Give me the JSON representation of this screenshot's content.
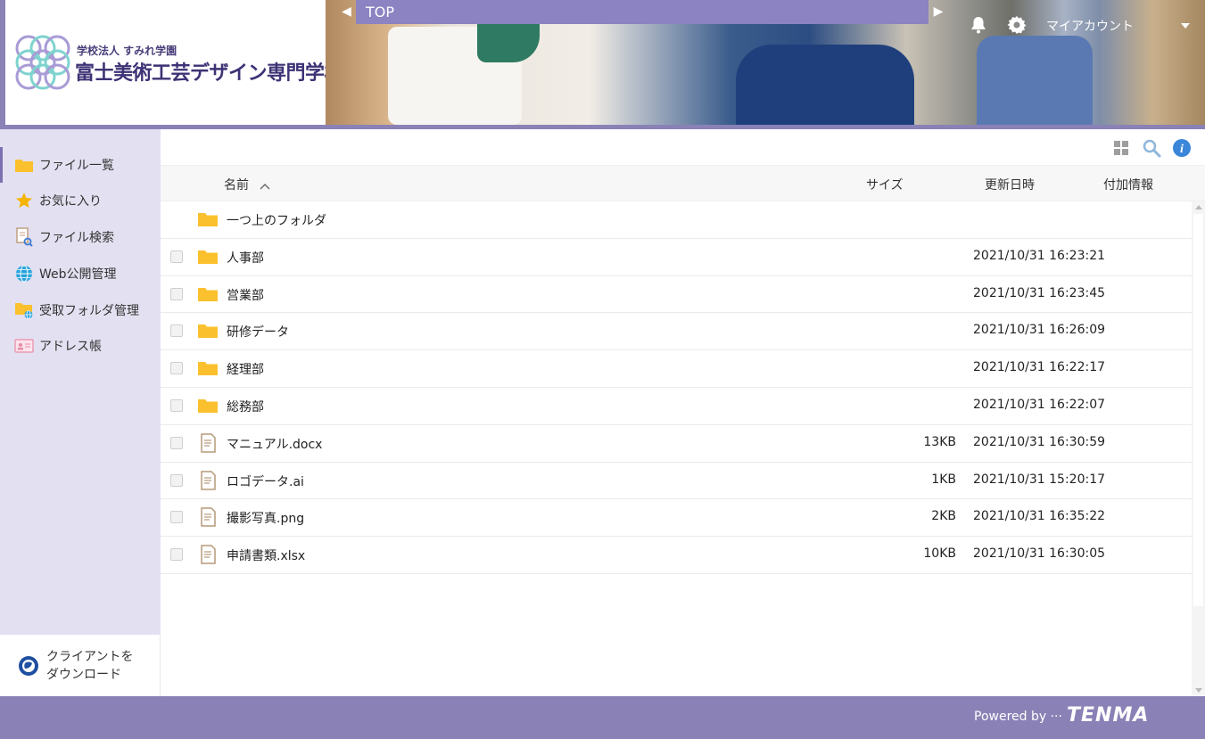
{
  "header": {
    "school_sub": "学校法人 すみれ学園",
    "school_name": "富士美術工芸デザイン専門学校",
    "top_title": "TOP",
    "account_label": "マイアカウント"
  },
  "sidebar": {
    "items": [
      {
        "label": "ファイル一覧",
        "icon": "folder-icon"
      },
      {
        "label": "お気に入り",
        "icon": "star-icon"
      },
      {
        "label": "ファイル検索",
        "icon": "file-search-icon"
      },
      {
        "label": "Web公開管理",
        "icon": "globe-icon"
      },
      {
        "label": "受取フォルダ管理",
        "icon": "folder-globe-icon"
      },
      {
        "label": "アドレス帳",
        "icon": "address-card-icon"
      }
    ],
    "client_download_line1": "クライアントを",
    "client_download_line2": "ダウンロード"
  },
  "table": {
    "columns": {
      "name": "名前",
      "size": "サイズ",
      "updated": "更新日時",
      "extra": "付加情報"
    },
    "parent_folder": "一つ上のフォルダ",
    "rows": [
      {
        "name": "人事部",
        "type": "folder",
        "size": "",
        "updated": "2021/10/31 16:23:21"
      },
      {
        "name": "営業部",
        "type": "folder",
        "size": "",
        "updated": "2021/10/31 16:23:45"
      },
      {
        "name": "研修データ",
        "type": "folder",
        "size": "",
        "updated": "2021/10/31 16:26:09"
      },
      {
        "name": "経理部",
        "type": "folder",
        "size": "",
        "updated": "2021/10/31 16:22:17"
      },
      {
        "name": "総務部",
        "type": "folder",
        "size": "",
        "updated": "2021/10/31 16:22:07"
      },
      {
        "name": "マニュアル.docx",
        "type": "file",
        "size": "13KB",
        "updated": "2021/10/31 16:30:59"
      },
      {
        "name": "ロゴデータ.ai",
        "type": "file",
        "size": "1KB",
        "updated": "2021/10/31 15:20:17"
      },
      {
        "name": "撮影写真.png",
        "type": "file",
        "size": "2KB",
        "updated": "2021/10/31 16:35:22"
      },
      {
        "name": "申請書類.xlsx",
        "type": "file",
        "size": "10KB",
        "updated": "2021/10/31 16:30:05"
      }
    ]
  },
  "footer": {
    "powered_by": "Powered by ···",
    "brand": "TENMA"
  },
  "colors": {
    "accent": "#8a82b6",
    "sidebar_bg": "#e3e0f1",
    "folder": "#fbc02d"
  }
}
